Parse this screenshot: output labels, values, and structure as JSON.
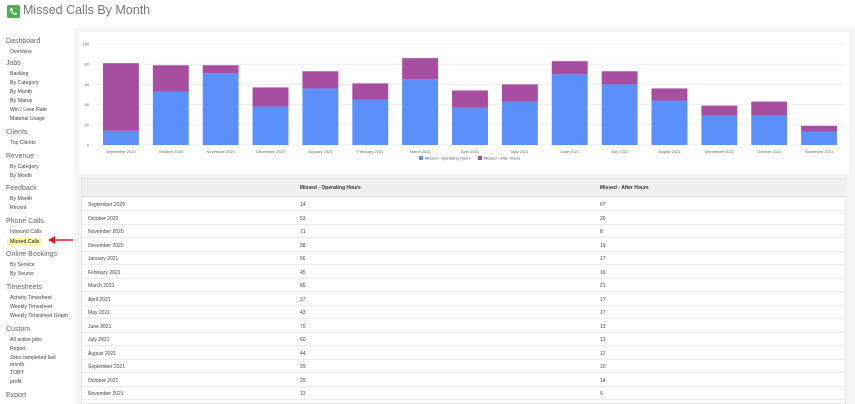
{
  "header": {
    "title": "Missed Calls By Month"
  },
  "sidebar": {
    "sections": [
      {
        "label": "Dashboard",
        "items": [
          "Overview"
        ]
      },
      {
        "label": "Jobs",
        "items": [
          "Backlog",
          "By Category",
          "By Month",
          "By Status",
          "Win / Lose Rate",
          "Material Usage"
        ]
      },
      {
        "label": "Clients",
        "items": [
          "Top Clients"
        ]
      },
      {
        "label": "Revenue",
        "items": [
          "By Category",
          "By Month"
        ]
      },
      {
        "label": "Feedback",
        "items": [
          "By Month",
          "Recent"
        ]
      },
      {
        "label": "Phone Calls",
        "items": [
          "Inbound Calls",
          "Missed Calls"
        ]
      },
      {
        "label": "Online Bookings",
        "items": [
          "By Service",
          "By Source"
        ]
      },
      {
        "label": "Timesheets",
        "items": [
          "Activity Timesheet",
          "Weekly Timesheet",
          "Weekly Timesheet Graph"
        ]
      },
      {
        "label": "Custom",
        "items": [
          "All active jobs",
          "Report",
          "Jobs completed last month",
          "TOBY",
          "profit"
        ]
      },
      {
        "label": "Export",
        "items": []
      }
    ],
    "active_item": "Missed Calls"
  },
  "chart_data": {
    "type": "bar",
    "stacked": true,
    "categories": [
      "September 2020",
      "October 2020",
      "November 2020",
      "December 2020",
      "January 2021",
      "February 2021",
      "March 2021",
      "April 2021",
      "May 2021",
      "June 2021",
      "July 2021",
      "August 2021",
      "September 2021",
      "October 2021",
      "November 2021"
    ],
    "series": [
      {
        "name": "Missed - Operating Hours",
        "color": "#5b8ff9",
        "values": [
          14,
          53,
          71,
          38,
          56,
          45,
          65,
          37,
          43,
          70,
          60,
          44,
          29,
          29,
          13
        ]
      },
      {
        "name": "Missed - After Hours",
        "color": "#a84ea0",
        "values": [
          67,
          26,
          8,
          19,
          17,
          16,
          21,
          17,
          17,
          13,
          13,
          12,
          10,
          14,
          6
        ]
      }
    ],
    "ylim": [
      0,
      100
    ],
    "yticks": [
      "0",
      "20",
      "40",
      "60",
      "80",
      "100"
    ],
    "legend": "bottom",
    "grid": true
  },
  "table": {
    "headers": [
      "",
      "Missed - Operating Hours",
      "Missed - After Hours"
    ],
    "rows": [
      [
        "September 2020",
        "14",
        "67"
      ],
      [
        "October 2020",
        "53",
        "26"
      ],
      [
        "November 2020",
        "71",
        "8"
      ],
      [
        "December 2020",
        "38",
        "19"
      ],
      [
        "January 2021",
        "56",
        "17"
      ],
      [
        "February 2021",
        "45",
        "16"
      ],
      [
        "March 2021",
        "65",
        "21"
      ],
      [
        "April 2021",
        "37",
        "17"
      ],
      [
        "May 2021",
        "43",
        "17"
      ],
      [
        "June 2021",
        "70",
        "13"
      ],
      [
        "July 2021",
        "60",
        "13"
      ],
      [
        "August 2021",
        "44",
        "12"
      ],
      [
        "September 2021",
        "29",
        "10"
      ],
      [
        "October 2021",
        "29",
        "14"
      ],
      [
        "November 2021",
        "13",
        "6"
      ]
    ]
  }
}
